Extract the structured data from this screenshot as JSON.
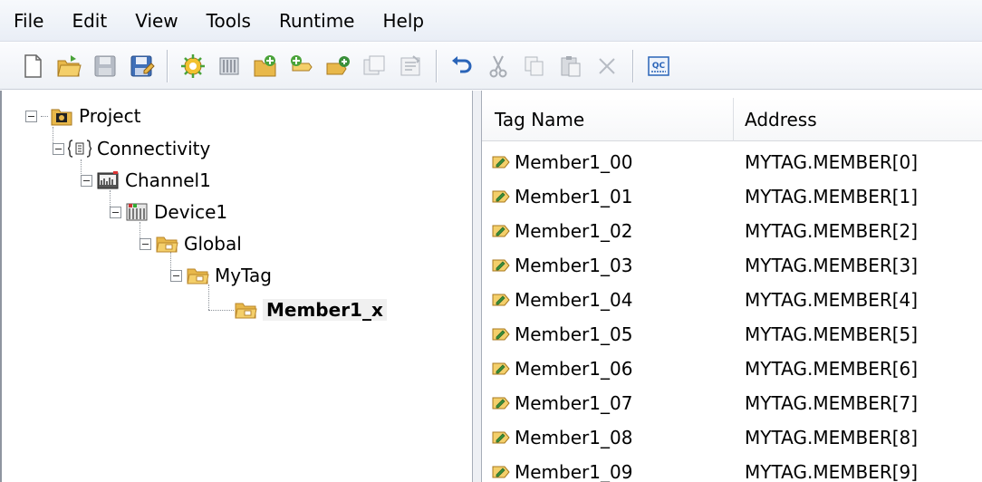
{
  "menu": [
    "File",
    "Edit",
    "View",
    "Tools",
    "Runtime",
    "Help"
  ],
  "toolbar": {
    "groups": [
      [
        "new-icon",
        "open-icon",
        "save-icon",
        "save-as-icon"
      ],
      [
        "new-channel-icon",
        "new-device-icon",
        "new-tag-group-icon",
        "new-tag-icon",
        "bulk-tag-icon",
        "duplicate-icon",
        "properties-icon"
      ],
      [
        "undo-icon",
        "cut-icon",
        "copy-icon",
        "paste-icon",
        "delete-icon"
      ],
      [
        "quick-client-icon"
      ]
    ],
    "quick_client_label": "QC"
  },
  "tree": {
    "project": "Project",
    "connectivity": "Connectivity",
    "channel": "Channel1",
    "device": "Device1",
    "global": "Global",
    "mytag": "MyTag",
    "member": "Member1_x"
  },
  "list": {
    "columns": [
      "Tag Name",
      "Address"
    ],
    "rows": [
      {
        "name": "Member1_00",
        "address": "MYTAG.MEMBER[0]"
      },
      {
        "name": "Member1_01",
        "address": "MYTAG.MEMBER[1]"
      },
      {
        "name": "Member1_02",
        "address": "MYTAG.MEMBER[2]"
      },
      {
        "name": "Member1_03",
        "address": "MYTAG.MEMBER[3]"
      },
      {
        "name": "Member1_04",
        "address": "MYTAG.MEMBER[4]"
      },
      {
        "name": "Member1_05",
        "address": "MYTAG.MEMBER[5]"
      },
      {
        "name": "Member1_06",
        "address": "MYTAG.MEMBER[6]"
      },
      {
        "name": "Member1_07",
        "address": "MYTAG.MEMBER[7]"
      },
      {
        "name": "Member1_08",
        "address": "MYTAG.MEMBER[8]"
      },
      {
        "name": "Member1_09",
        "address": "MYTAG.MEMBER[9]"
      }
    ]
  },
  "colors": {
    "folder": "#e8b84a",
    "folder_dark": "#b9862a",
    "accent_blue": "#2a64b8"
  }
}
